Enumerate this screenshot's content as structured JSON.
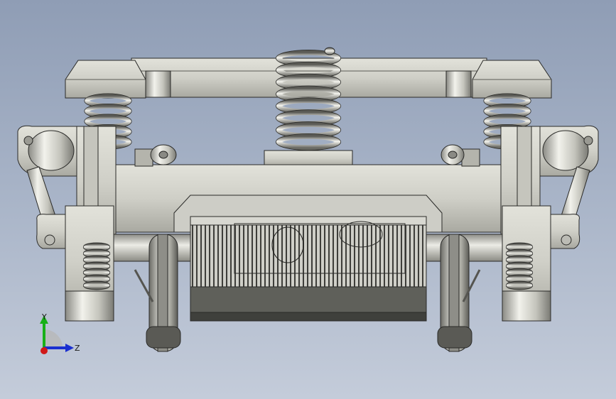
{
  "triad": {
    "y_label": "Y",
    "z_label": "Z",
    "x_color": "#d01818",
    "y_color": "#18b018",
    "z_color": "#1a2fd0"
  },
  "colors": {
    "background_top": "#8f9db5",
    "background_bottom": "#c4ccda",
    "metal_light": "#d6d6cf",
    "metal_mid": "#b8b8b0",
    "metal_dark": "#7d7d76",
    "housing_dark": "#5f605a"
  }
}
